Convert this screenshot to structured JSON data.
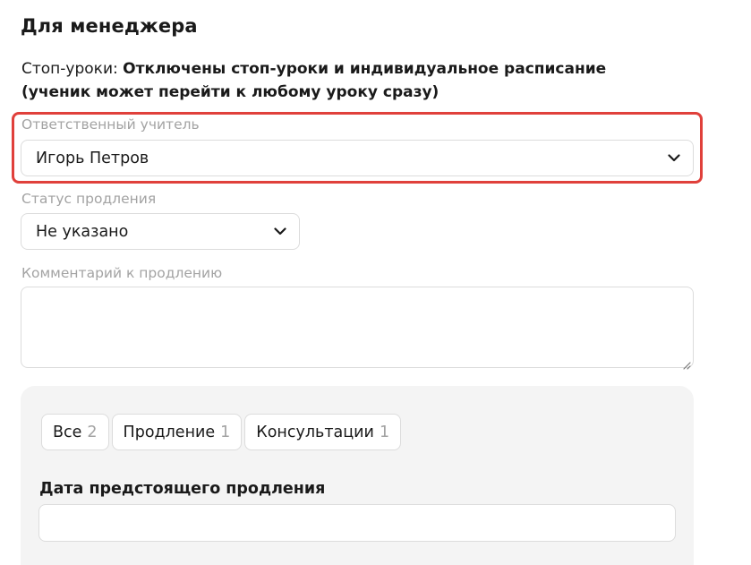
{
  "section": {
    "title": "Для менеджера"
  },
  "stop_lessons": {
    "label": "Стоп-уроки:",
    "value": "Отключены стоп-уроки и индивидуальное расписание (ученик может перейти к любому уроку сразу)"
  },
  "teacher": {
    "label": "Ответственный учитель",
    "selected": "Игорь Петров",
    "icon": "chevron-down-icon",
    "highlight_color": "#e0403b"
  },
  "renewal_status": {
    "label": "Статус продления",
    "selected": "Не указано",
    "icon": "chevron-down-icon"
  },
  "renewal_comment": {
    "label": "Комментарий к продлению",
    "value": ""
  },
  "panel": {
    "tabs": [
      {
        "label": "Все",
        "count": "2"
      },
      {
        "label": "Продление",
        "count": "1"
      },
      {
        "label": "Консультации",
        "count": "1"
      }
    ],
    "upcoming_renewal_date": {
      "label": "Дата предстоящего продления",
      "value": ""
    }
  }
}
